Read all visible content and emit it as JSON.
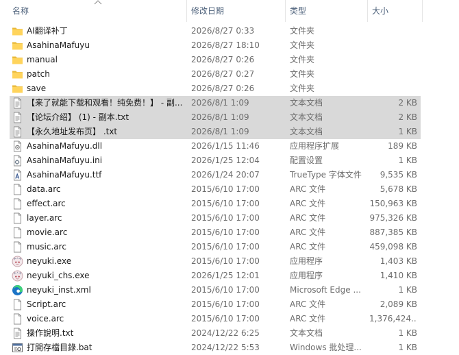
{
  "columns": {
    "name": "名称",
    "date": "修改日期",
    "type": "类型",
    "size": "大小"
  },
  "files": [
    {
      "name": "AI翻译补丁",
      "date": "2026/8/27 0:33",
      "type": "文件夹",
      "size": "",
      "icon": "folder-icon"
    },
    {
      "name": "AsahinaMafuyu",
      "date": "2026/8/27 18:10",
      "type": "文件夹",
      "size": "",
      "icon": "folder-icon"
    },
    {
      "name": "manual",
      "date": "2026/8/27 0:26",
      "type": "文件夹",
      "size": "",
      "icon": "folder-icon"
    },
    {
      "name": "patch",
      "date": "2026/8/27 0:27",
      "type": "文件夹",
      "size": "",
      "icon": "folder-icon"
    },
    {
      "name": "save",
      "date": "2026/8/27 0:26",
      "type": "文件夹",
      "size": "",
      "icon": "folder-icon"
    },
    {
      "name": "【来了就能下载和观看！纯免费！】 - 副...",
      "date": "2026/8/1 1:09",
      "type": "文本文档",
      "size": "2 KB",
      "icon": "text-file-icon",
      "selected": true
    },
    {
      "name": "【论坛介绍】 (1) - 副本.txt",
      "date": "2026/8/1 1:09",
      "type": "文本文档",
      "size": "2 KB",
      "icon": "text-file-icon",
      "selected": true
    },
    {
      "name": "【永久地址发布页】 .txt",
      "date": "2026/8/1 1:09",
      "type": "文本文档",
      "size": "1 KB",
      "icon": "text-file-icon",
      "selected": true
    },
    {
      "name": "AsahinaMafuyu.dll",
      "date": "2026/1/15 11:46",
      "type": "应用程序扩展",
      "size": "189 KB",
      "icon": "dll-file-icon"
    },
    {
      "name": "AsahinaMafuyu.ini",
      "date": "2026/1/25 12:04",
      "type": "配置设置",
      "size": "1 KB",
      "icon": "ini-file-icon"
    },
    {
      "name": "AsahinaMafuyu.ttf",
      "date": "2026/1/24 20:07",
      "type": "TrueType 字体文件",
      "size": "9,535 KB",
      "icon": "font-file-icon"
    },
    {
      "name": "data.arc",
      "date": "2015/6/10 17:00",
      "type": "ARC 文件",
      "size": "5,678 KB",
      "icon": "blank-file-icon"
    },
    {
      "name": "effect.arc",
      "date": "2015/6/10 17:00",
      "type": "ARC 文件",
      "size": "150,963 KB",
      "icon": "blank-file-icon"
    },
    {
      "name": "layer.arc",
      "date": "2015/6/10 17:00",
      "type": "ARC 文件",
      "size": "975,326 KB",
      "icon": "blank-file-icon"
    },
    {
      "name": "movie.arc",
      "date": "2015/6/10 17:00",
      "type": "ARC 文件",
      "size": "887,385 KB",
      "icon": "blank-file-icon"
    },
    {
      "name": "music.arc",
      "date": "2015/6/10 17:00",
      "type": "ARC 文件",
      "size": "459,098 KB",
      "icon": "blank-file-icon"
    },
    {
      "name": "neyuki.exe",
      "date": "2015/6/10 17:00",
      "type": "应用程序",
      "size": "1,403 KB",
      "icon": "app-icon"
    },
    {
      "name": "neyuki_chs.exe",
      "date": "2026/1/25 12:01",
      "type": "应用程序",
      "size": "1,410 KB",
      "icon": "app-icon"
    },
    {
      "name": "neyuki_inst.xml",
      "date": "2015/6/10 17:00",
      "type": "Microsoft Edge ...",
      "size": "1 KB",
      "icon": "edge-icon"
    },
    {
      "name": "Script.arc",
      "date": "2015/6/10 17:00",
      "type": "ARC 文件",
      "size": "2,089 KB",
      "icon": "blank-file-icon"
    },
    {
      "name": "voice.arc",
      "date": "2015/6/10 17:00",
      "type": "ARC 文件",
      "size": "1,376,424...",
      "icon": "blank-file-icon"
    },
    {
      "name": "操作說明.txt",
      "date": "2024/12/22 6:25",
      "type": "文本文档",
      "size": "1 KB",
      "icon": "text-file-icon"
    },
    {
      "name": "打開存檔目錄.bat",
      "date": "2024/12/22 5:53",
      "type": "Windows 批处理...",
      "size": "1 KB",
      "icon": "bat-file-icon"
    }
  ]
}
